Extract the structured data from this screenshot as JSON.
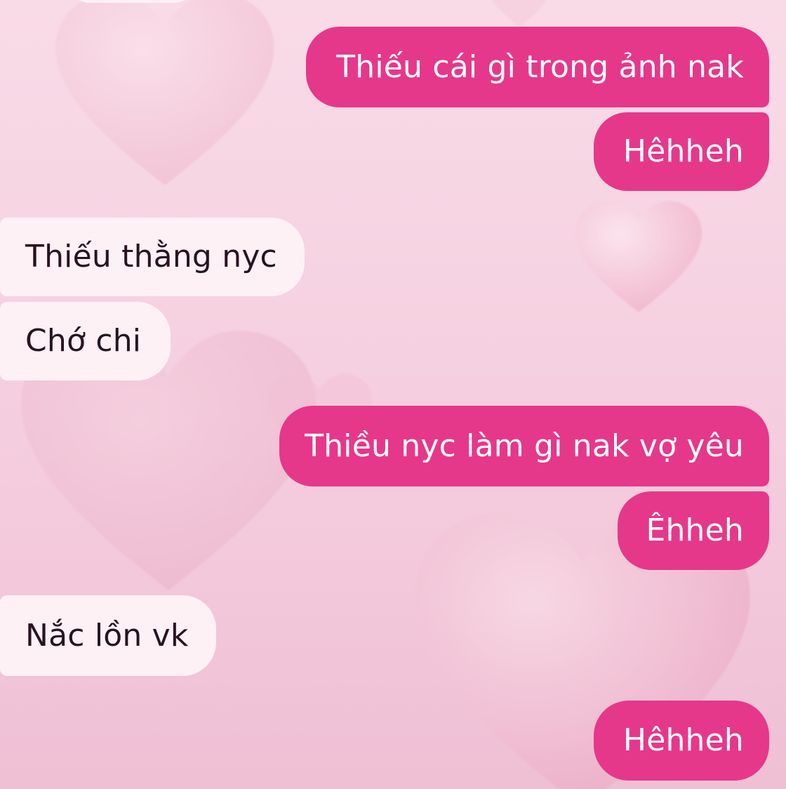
{
  "theme": {
    "outgoing_bubble_color": "#e5388b",
    "incoming_bubble_color": "#fdf1f5",
    "outgoing_text_color": "#ffffff",
    "incoming_text_color": "#2a1222",
    "background_color": "#f6d3e2"
  },
  "background": {
    "decoration": "heart-icon"
  },
  "messages": [
    {
      "direction": "outgoing",
      "text": "Thiếu cái gì trong ảnh nak"
    },
    {
      "direction": "outgoing",
      "text": "Hêhheh"
    },
    {
      "direction": "incoming",
      "text": "Thiếu thằng nyc"
    },
    {
      "direction": "incoming",
      "text": "Chớ chi"
    },
    {
      "direction": "outgoing",
      "text": "Thiều nyc làm gì nak vợ yêu"
    },
    {
      "direction": "outgoing",
      "text": "Êhheh"
    },
    {
      "direction": "incoming",
      "text": "Nắc lồn vk"
    },
    {
      "direction": "outgoing",
      "text": "Hêhheh"
    }
  ]
}
